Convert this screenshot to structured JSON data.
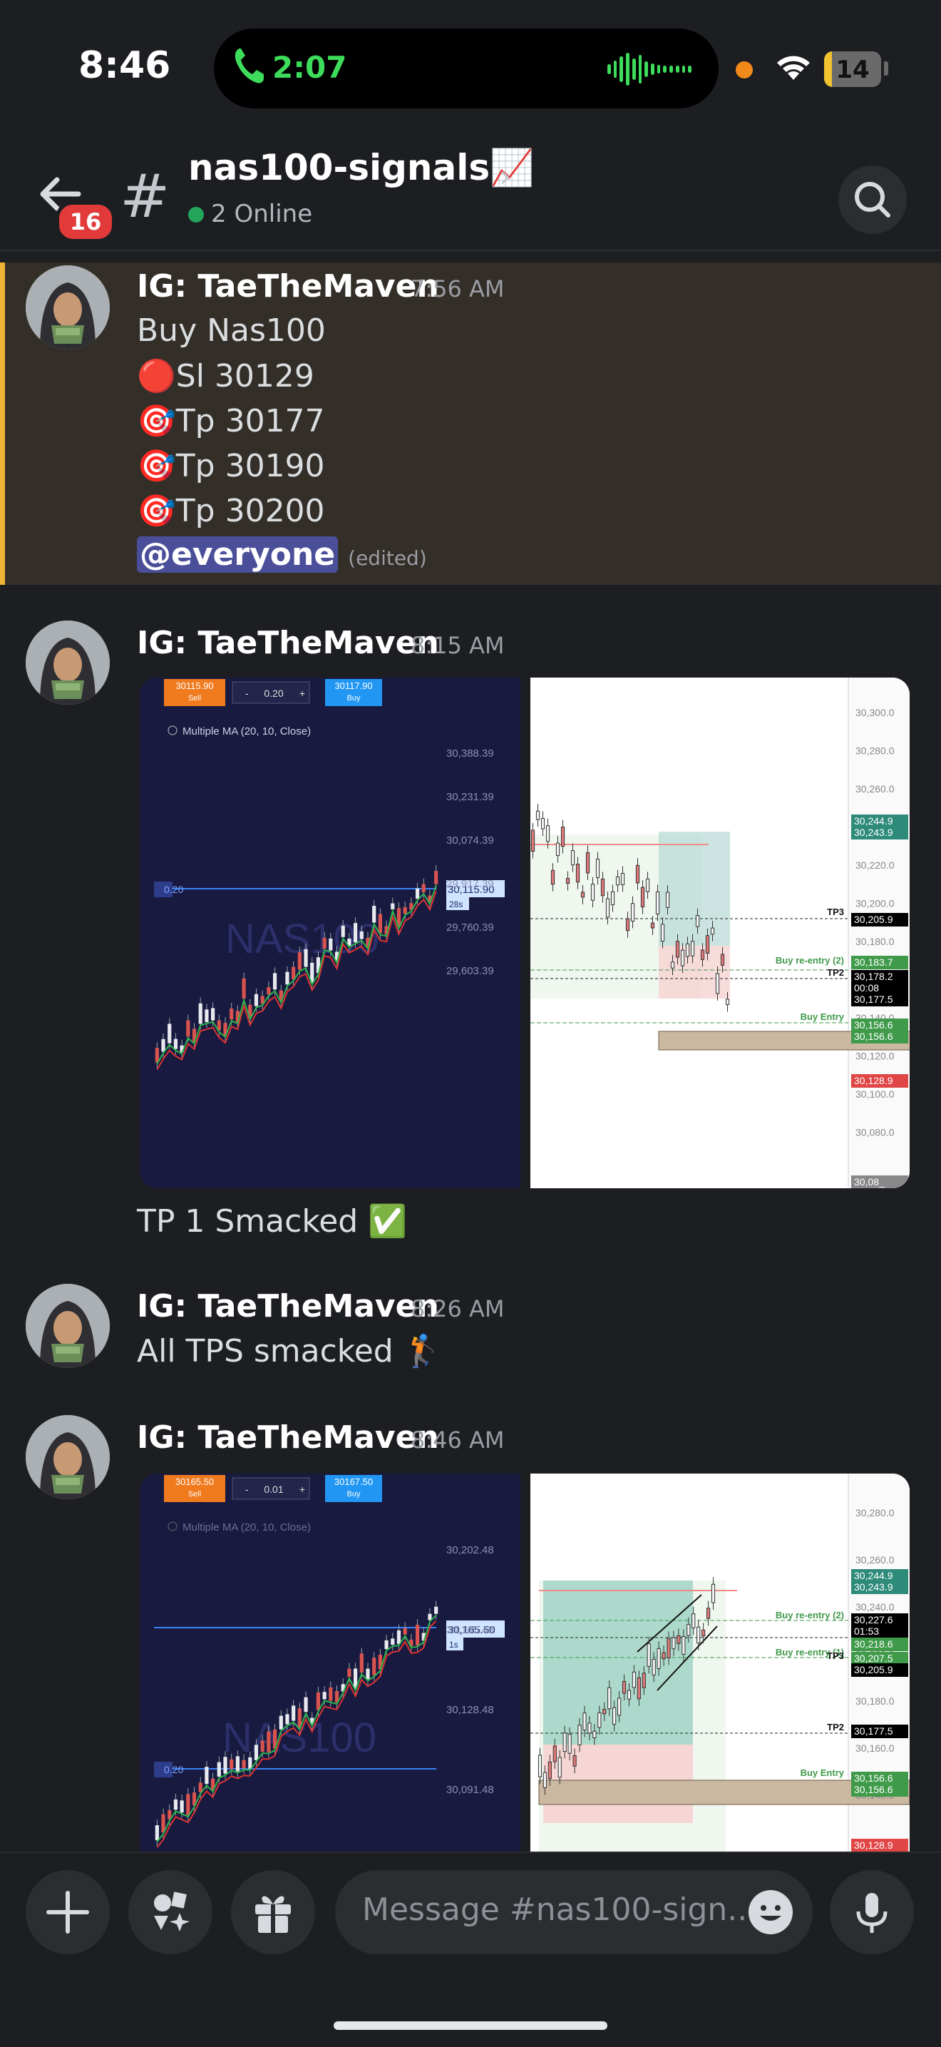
{
  "status_bar": {
    "time": "8:46",
    "call_duration": "2:07",
    "battery": "14",
    "battery_level_percent": 14,
    "icons": [
      "phone-icon",
      "audio-waveform-icon",
      "recording-dot-icon",
      "wifi-icon",
      "battery-icon"
    ]
  },
  "header": {
    "back_badge_count": "16",
    "hash_symbol": "#",
    "channel_name": "nas100-signals📈",
    "chevron": "›",
    "online_status": "2 Online",
    "icons": [
      "back-arrow-icon",
      "search-icon"
    ]
  },
  "messages": [
    {
      "author": "IG: TaeTheMaven",
      "time": "7:56 AM",
      "highlighted": true,
      "lines": [
        "Buy Nas100",
        "🔴Sl 30129",
        "🎯Tp 30177",
        "🎯Tp 30190",
        "🎯Tp 30200"
      ],
      "mention": "@everyone",
      "edited": "(edited)"
    },
    {
      "author": "IG: TaeTheMaven",
      "time": "8:15 AM",
      "caption": "TP 1 Smacked ✅",
      "chart_left": {
        "sell_price": "30115.90",
        "sell_label": "Sell",
        "minus": "-",
        "qty": "0.20",
        "plus": "+",
        "buy_price": "30117.90",
        "buy_label": "Buy",
        "indicator": "Multiple MA (20, 10, Close)",
        "watermark": "NAS100",
        "price_tag": "30,115.90",
        "price_tag_sub": "28s",
        "position_tag": "0.20",
        "y_labels": [
          "30,388.39",
          "30,231.39",
          "30,074.39",
          "29,917.39",
          "29,760.39",
          "29,603.39"
        ]
      },
      "chart_right": {
        "y_labels": [
          "30,300.0",
          "30,280.0",
          "30,260.0",
          "30,240.0",
          "30,220.0",
          "30,200.0",
          "30,180.0",
          "30,160.0",
          "30,140.0",
          "30,120.0",
          "30,100.0",
          "30,080.0"
        ],
        "tags": [
          {
            "text": "30,244.9",
            "color": "#2e8b7a"
          },
          {
            "text": "30,243.9",
            "color": "#2e8b7a"
          },
          {
            "text": "30,205.9",
            "color": "#000000"
          },
          {
            "text": "30,183.7",
            "color": "#3f9a4a"
          },
          {
            "text": "30,178.2",
            "color": "#000000"
          },
          {
            "text": "00:08",
            "color": "#000000"
          },
          {
            "text": "30,177.5",
            "color": "#000000"
          },
          {
            "text": "30,156.6",
            "color": "#3f9a4a"
          },
          {
            "text": "30,156.6",
            "color": "#3f9a4a"
          },
          {
            "text": "30,128.9",
            "color": "#e04646"
          },
          {
            "text": "30,08_",
            "color": "#888888"
          }
        ],
        "labels": [
          "TP3",
          "Buy re-entry (2)",
          "TP2",
          "Buy Entry"
        ]
      }
    },
    {
      "author": "IG: TaeTheMaven",
      "time": "8:26 AM",
      "text": "All TPS smacked 🏌️"
    },
    {
      "author": "IG: TaeTheMaven",
      "time": "8:46 AM",
      "chart_left": {
        "sell_price": "30165.50",
        "sell_label": "Sell",
        "minus": "-",
        "qty": "0.01",
        "plus": "+",
        "buy_price": "30167.50",
        "buy_label": "Buy",
        "indicator": "Multiple MA (20, 10, Close)",
        "watermark": "NAS100",
        "price_tag": "30,165.50",
        "price_tag_sub": "1s",
        "position_tag": "0.20",
        "y_labels": [
          "30,202.48",
          "30,165.48",
          "30,128.48",
          "30,091.48"
        ]
      },
      "chart_right": {
        "y_labels": [
          "30,280.0",
          "30,260.0",
          "30,240.0",
          "30,200.0",
          "30,180.0",
          "30,160.0",
          "30,140.0",
          "30,120.0"
        ],
        "tags": [
          {
            "text": "30,244.9",
            "color": "#2e8b7a"
          },
          {
            "text": "30,243.9",
            "color": "#2e8b7a"
          },
          {
            "text": "30,227.6",
            "color": "#000000"
          },
          {
            "text": "01:53",
            "color": "#000000"
          },
          {
            "text": "30,218.6",
            "color": "#3f9a4a"
          },
          {
            "text": "30,207.5",
            "color": "#3f9a4a"
          },
          {
            "text": "30,205.9",
            "color": "#000000"
          },
          {
            "text": "30,177.5",
            "color": "#000000"
          },
          {
            "text": "30,156.6",
            "color": "#3f9a4a"
          },
          {
            "text": "30,156.6",
            "color": "#3f9a4a"
          },
          {
            "text": "30,128.9",
            "color": "#e04646"
          }
        ],
        "labels": [
          "Buy re-entry (2)",
          "Buy re-entry (1)",
          "TP3",
          "TP2",
          "Buy Entry"
        ]
      }
    }
  ],
  "composer": {
    "placeholder": "Message #nas100-sign...",
    "icons": [
      "plus-icon",
      "apps-icon",
      "gift-icon",
      "emoji-icon",
      "microphone-icon"
    ]
  },
  "colors": {
    "background": "#1d1e22",
    "highlight": "#332f28",
    "highlight_bar": "#f0b232",
    "online": "#23a55a",
    "badge": "#e23a3a",
    "call_green": "#3ddc5a",
    "mention": "#4b4f9a"
  }
}
